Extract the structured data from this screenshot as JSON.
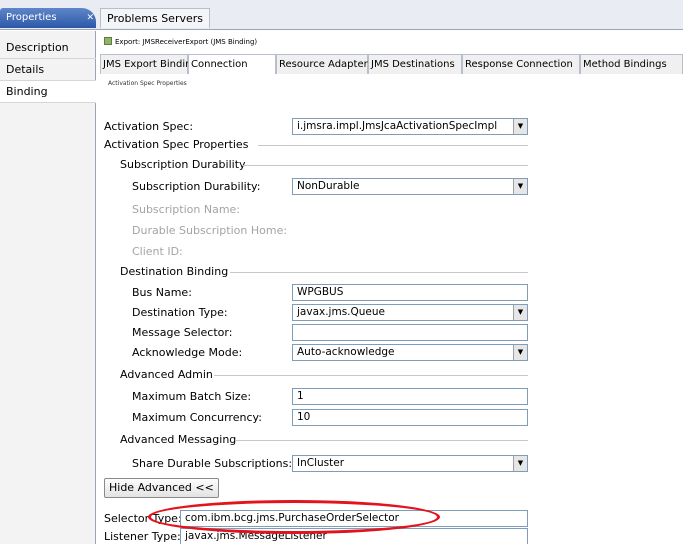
{
  "view_tabs": {
    "properties": "Properties",
    "problems": "Problems Servers"
  },
  "sidebar": {
    "items": [
      {
        "label": "Description"
      },
      {
        "label": "Details"
      },
      {
        "label": "Binding"
      }
    ]
  },
  "header": {
    "export_title": "Export: JMSReceiverExport (JMS Binding)"
  },
  "subtabs": [
    {
      "label": "JMS Export Binding"
    },
    {
      "label": "Connection"
    },
    {
      "label": "Resource Adapter"
    },
    {
      "label": "JMS Destinations"
    },
    {
      "label": "Response Connection"
    },
    {
      "label": "Method Bindings"
    }
  ],
  "section_title": "Activation Spec Properties",
  "form": {
    "activation_spec_label": "Activation Spec:",
    "activation_spec_value": "i.jmsra.impl.JmsJcaActivationSpecImpl",
    "activation_spec_props_group": "Activation Spec Properties",
    "subscription_durability_group": "Subscription Durability",
    "subscription_durability_label": "Subscription Durability:",
    "subscription_durability_value": "NonDurable",
    "subscription_name_label": "Subscription Name:",
    "durable_subscription_home_label": "Durable Subscription Home:",
    "client_id_label": "Client ID:",
    "destination_binding_group": "Destination Binding",
    "bus_name_label": "Bus Name:",
    "bus_name_value": "WPGBUS",
    "destination_type_label": "Destination Type:",
    "destination_type_value": "javax.jms.Queue",
    "message_selector_label": "Message Selector:",
    "message_selector_value": "",
    "acknowledge_mode_label": "Acknowledge Mode:",
    "acknowledge_mode_value": "Auto-acknowledge",
    "advanced_admin_group": "Advanced Admin",
    "max_batch_size_label": "Maximum Batch Size:",
    "max_batch_size_value": "1",
    "max_concurrency_label": "Maximum Concurrency:",
    "max_concurrency_value": "10",
    "advanced_messaging_group": "Advanced Messaging",
    "share_durable_label": "Share Durable Subscriptions:",
    "share_durable_value": "InCluster",
    "hide_advanced_button": "Hide Advanced <<",
    "selector_type_label": "Selector Type:",
    "selector_type_value": "com.ibm.bcg.jms.PurchaseOrderSelector",
    "listener_type_label": "Listener Type:",
    "listener_type_value": "javax.jms.MessageListener"
  },
  "colors": {
    "highlight": "#e3121b",
    "active_view_tab": "#2b58a8"
  }
}
